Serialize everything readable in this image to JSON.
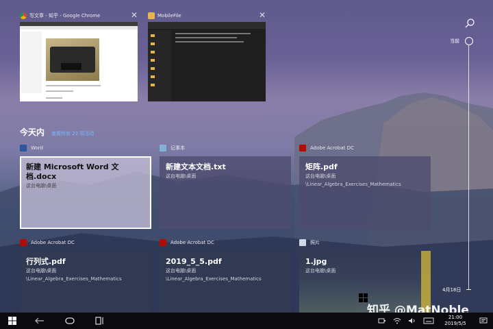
{
  "windows": [
    {
      "title": "写文章 - 知乎 - Google Chrome",
      "app_icon": "chrome-icon",
      "close_label": "✕"
    },
    {
      "title": "MobileFile",
      "app_icon": "folder-icon",
      "close_label": "✕"
    }
  ],
  "section": {
    "title": "今天内",
    "link": "查看所有 22 项活动"
  },
  "cards": [
    {
      "app": "Word",
      "title": "新建 Microsoft Word 文档.docx",
      "subs": [
        "这台电脑\\桌面"
      ],
      "badge_color": "#2b579a"
    },
    {
      "app": "记事本",
      "title": "新建文本文档.txt",
      "subs": [
        "这台电脑\\桌面"
      ],
      "badge_color": "#7fb3d5"
    },
    {
      "app": "Adobe Acrobat DC",
      "title": "矩阵.pdf",
      "subs": [
        "这台电脑\\桌面",
        "\\Linear_Algebra_Exercises_Mathematics"
      ],
      "badge_color": "#b30b00"
    },
    {
      "app": "Adobe Acrobat DC",
      "title": "行列式.pdf",
      "subs": [
        "这台电脑\\桌面",
        "\\Linear_Algebra_Exercises_Mathematics"
      ],
      "badge_color": "#b30b00"
    },
    {
      "app": "Adobe Acrobat DC",
      "title": "2019_5_5.pdf",
      "subs": [
        "这台电脑\\桌面",
        "\\Linear_Algebra_Exercises_Mathematics"
      ],
      "badge_color": "#b30b00"
    },
    {
      "app": "照片",
      "title": "1.jpg",
      "subs": [
        "这台电脑\\桌面"
      ],
      "badge_color": "#cfd8e6"
    }
  ],
  "timeline": {
    "top_label": "当前",
    "bottom_label": "4月18日"
  },
  "watermark": "知乎 @MatNoble",
  "taskbar": {
    "time": "21:00",
    "date": "2019/5/5"
  },
  "colors": {
    "accent_link": "#7ab8ff",
    "pdf_red": "#b30b00",
    "word_blue": "#2b579a"
  }
}
